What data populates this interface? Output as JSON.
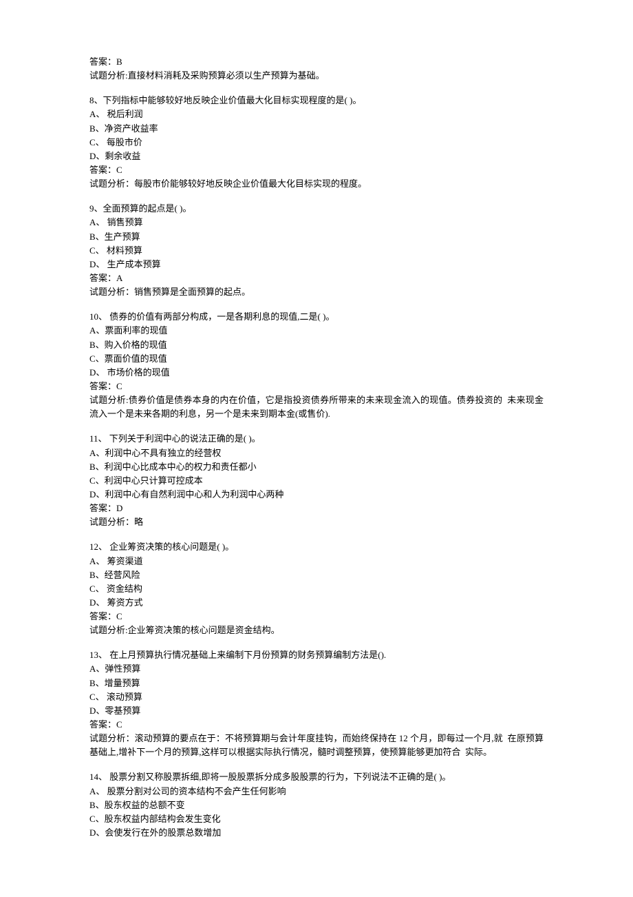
{
  "q7answer": {
    "answer": "答案：B",
    "analysis": "试题分析:直接材料消耗及采购预算必须以生产预算为基础。"
  },
  "questions": [
    {
      "stem": "8、下列指标中能够较好地反映企业价值最大化目标实现程度的是( )。",
      "options": [
        "A、 税后利润",
        "B、净资产收益率",
        "C、 每股市价",
        "D、剩余收益"
      ],
      "answer": "答案：C",
      "analysis": "试题分析：每股市价能够较好地反映企业价值最大化目标实现的程度。"
    },
    {
      "stem": "9、全面预算的起点是( )。",
      "options": [
        "A、 销售预算",
        "B、生产预算",
        "C、 材料预算",
        "D、 生产成本预算"
      ],
      "answer": "答案：A",
      "analysis": "试题分析：销售预算是全面预算的起点。"
    },
    {
      "stem": "10、 债券的价值有两部分构成，一是各期利息的现值,二是( )。",
      "options": [
        "A、票面利率的现值",
        "B、购入价格的现值",
        "C、票面价值的现值",
        "D、 市场价格的现值"
      ],
      "answer": "答案：C",
      "analysis": "试题分析:债券价值是债券本身的内在价值，它是指投资债券所带来的未来现金流入的现值。债券投资的  未来现金流入一个是未来各期的利息，另一个是未来到期本金(或售价)."
    },
    {
      "stem": "11、 下列关于利润中心的说法正确的是( )。",
      "options": [
        "A、利润中心不具有独立的经营权",
        "B、利润中心比成本中心的权力和责任都小",
        "C、利润中心只计算可控成本",
        "D、利润中心有自然利润中心和人为利润中心两种"
      ],
      "answer": "答案：D",
      "analysis": "试题分析：略"
    },
    {
      "stem": "12、 企业筹资决策的核心问题是( )。",
      "options": [
        "A、 筹资渠道",
        "B、经营风险",
        "C、 资金结构",
        "D、 筹资方式"
      ],
      "answer": "答案：C",
      "analysis": "试题分析:企业筹资决策的核心问题是资金结构。"
    },
    {
      "stem": "13、 在上月预算执行情况基础上来编制下月份预算的财务预算编制方法是().",
      "options": [
        "A、弹性预算",
        "B、增量预算",
        "C、 滚动预算",
        "D、零基预算"
      ],
      "answer": "答案：C",
      "analysis": "试题分析：滚动预算的要点在于：不将预算期与会计年度挂钩，而始终保持在 12 个月，即每过一个月,就  在原预算基础上,增补下一个月的预算,这样可以根据实际执行情况，髓时调整预算，使预算能够更加符合  实际。"
    },
    {
      "stem": "14、 股票分割又称股票拆细,即将一股股票拆分成多股股票的行为，下列说法不正确的是( )。",
      "options": [
        "A、 股票分割对公司的资本结构不会产生任何影响",
        "B、股东权益的总额不变",
        "C、股东权益内部结构会发生变化",
        "D、会使发行在外的股票总数增加"
      ],
      "answer": "",
      "analysis": ""
    }
  ]
}
